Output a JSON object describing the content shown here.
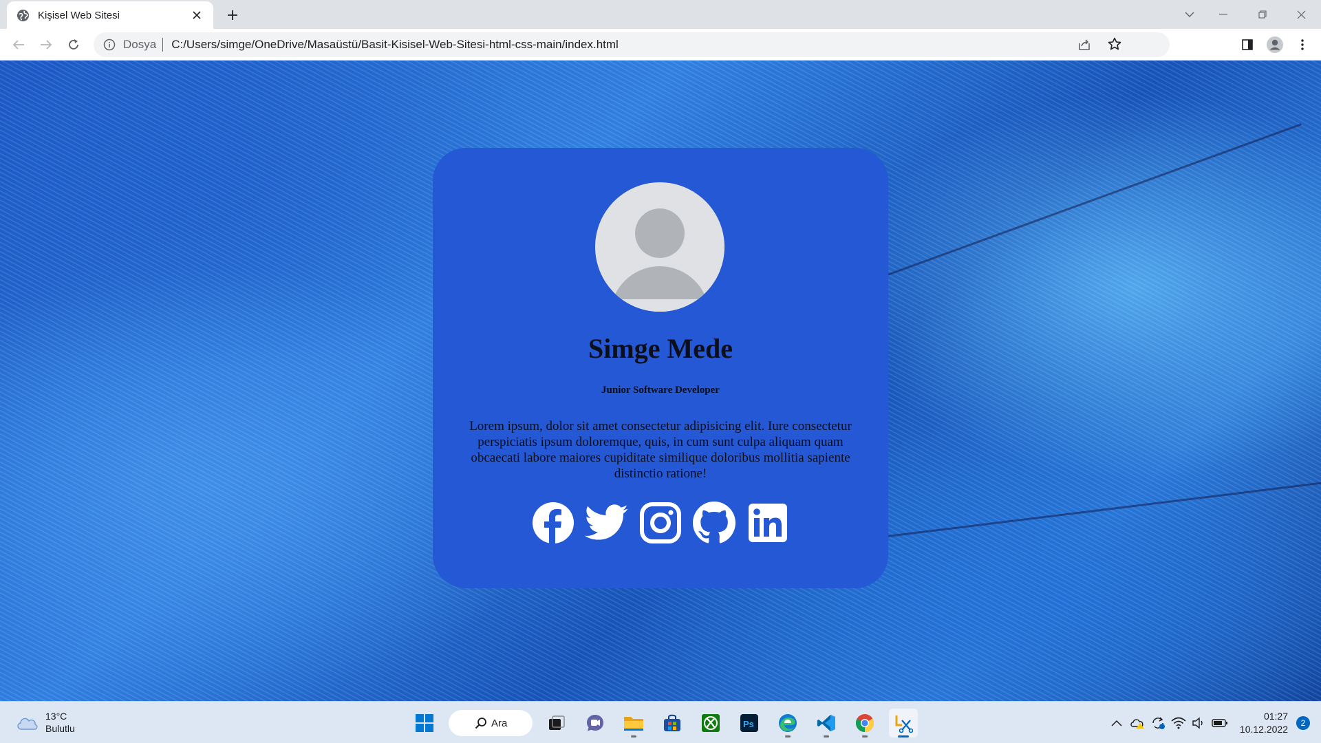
{
  "browser": {
    "tab_title": "Kişisel Web Sitesi",
    "scheme_label": "Dosya",
    "url": "C:/Users/simge/OneDrive/Masaüstü/Basit-Kisisel-Web-Sitesi-html-css-main/index.html"
  },
  "page": {
    "name": "Simge Mede",
    "role": "Junior Software Developer",
    "bio": "Lorem ipsum, dolor sit amet consectetur adipisicing elit. Iure consectetur perspiciatis ipsum doloremque, quis, in cum sunt culpa aliquam quam obcaecati labore maiores cupiditate similique doloribus mollitia sapiente distinctio ratione!",
    "card_color": "#2558d4",
    "social_links": [
      "facebook-icon",
      "twitter-icon",
      "instagram-icon",
      "github-icon",
      "linkedin-icon"
    ]
  },
  "taskbar": {
    "weather_temp": "13°C",
    "weather_condition": "Bulutlu",
    "search_label": "Ara",
    "apps": [
      "start-icon",
      "search",
      "task-view-icon",
      "teams-chat-icon",
      "file-explorer-icon",
      "microsoft-store-icon",
      "xbox-icon",
      "photoshop-icon",
      "edge-icon",
      "vscode-icon",
      "chrome-icon",
      "snipping-tool-icon"
    ],
    "time": "01:27",
    "date": "10.12.2022",
    "notification_count": "2"
  }
}
